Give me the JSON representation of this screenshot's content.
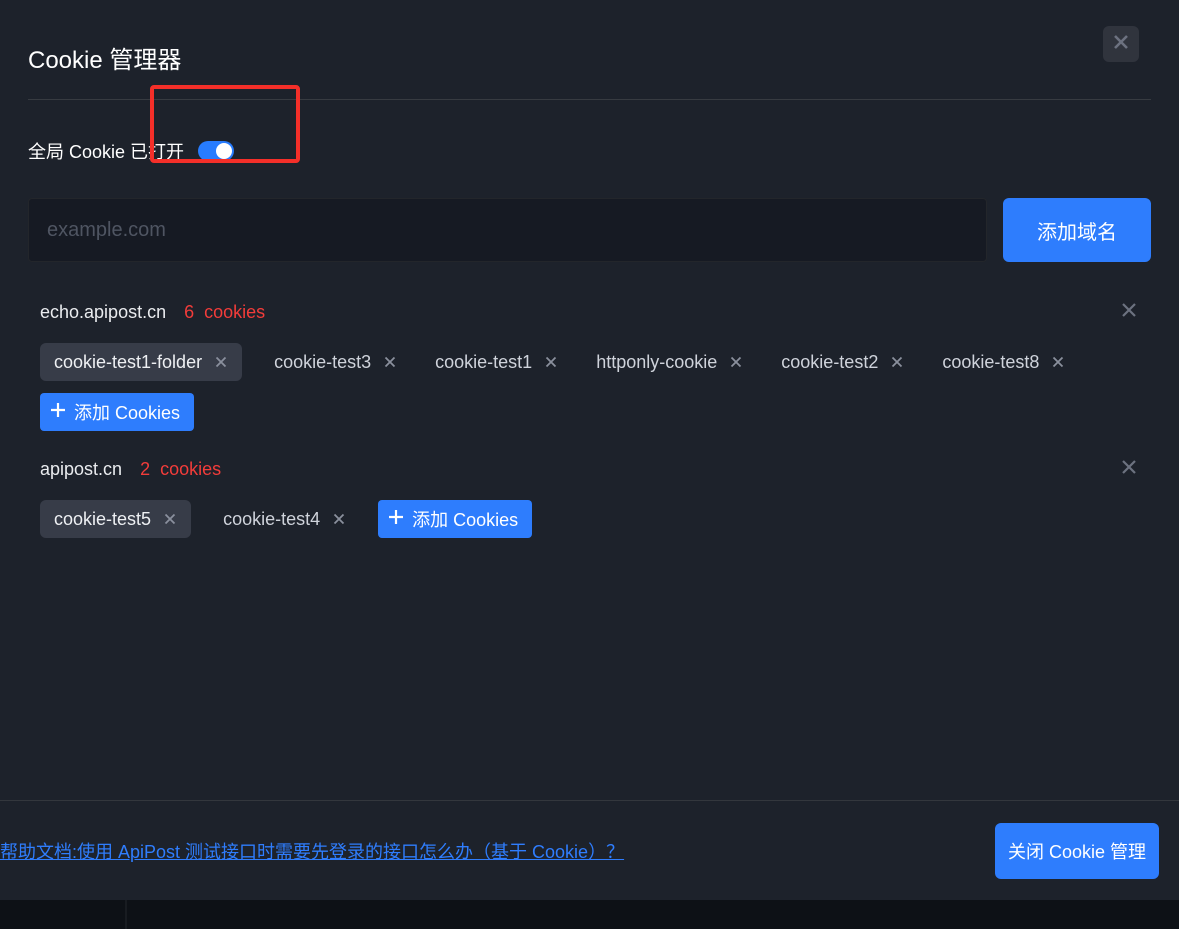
{
  "modal": {
    "title": "Cookie 管理器",
    "global_toggle_label": "全局 Cookie 已打开",
    "domain_input_placeholder": "example.com",
    "add_domain_button": "添加域名",
    "add_cookies_button": "添加 Cookies",
    "help_link": "帮助文档:使用 ApiPost 测试接口时需要先登录的接口怎么办（基于 Cookie）？",
    "close_manager_button": "关闭 Cookie 管理",
    "cookies_word": "cookies"
  },
  "domains": [
    {
      "name": "echo.apipost.cn",
      "count": "6",
      "cookies": [
        {
          "name": "cookie-test1-folder",
          "filled": true
        },
        {
          "name": "cookie-test3",
          "filled": false
        },
        {
          "name": "cookie-test1",
          "filled": false
        },
        {
          "name": "httponly-cookie",
          "filled": false
        },
        {
          "name": "cookie-test2",
          "filled": false
        },
        {
          "name": "cookie-test8",
          "filled": false
        }
      ]
    },
    {
      "name": "apipost.cn",
      "count": "2",
      "cookies": [
        {
          "name": "cookie-test5",
          "filled": true
        },
        {
          "name": "cookie-test4",
          "filled": false
        }
      ]
    }
  ]
}
